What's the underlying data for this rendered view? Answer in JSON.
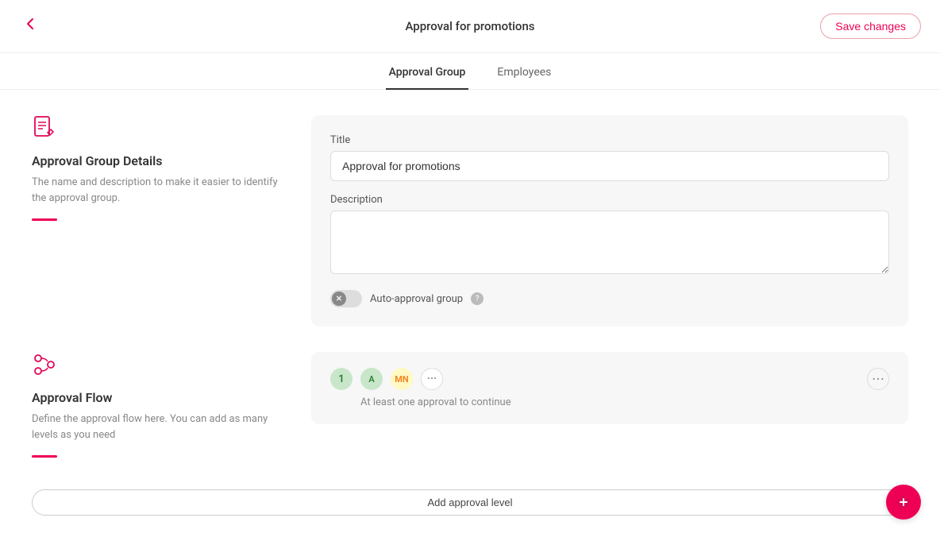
{
  "header": {
    "title": "Approval for promotions",
    "save_label": "Save changes"
  },
  "tabs": [
    {
      "label": "Approval Group",
      "active": true
    },
    {
      "label": "Employees",
      "active": false
    }
  ],
  "approval_group_section": {
    "title": "Approval Group Details",
    "description": "The name and description to make it easier to identify the approval group.",
    "form": {
      "title_label": "Title",
      "title_value": "Approval for promotions",
      "title_placeholder": "",
      "description_label": "Description",
      "description_value": "",
      "toggle_label": "Auto-approval group",
      "help": "?"
    }
  },
  "approval_flow_section": {
    "title": "Approval Flow",
    "description": "Define the approval flow here. You can add as many levels as you need",
    "level": {
      "number": "1",
      "approvers": [
        {
          "initials": "A",
          "style": "avatar-a"
        },
        {
          "initials": "MN",
          "style": "avatar-mn"
        }
      ],
      "more": "···",
      "note": "At least one approval to continue"
    },
    "add_btn": "Add approval level"
  }
}
